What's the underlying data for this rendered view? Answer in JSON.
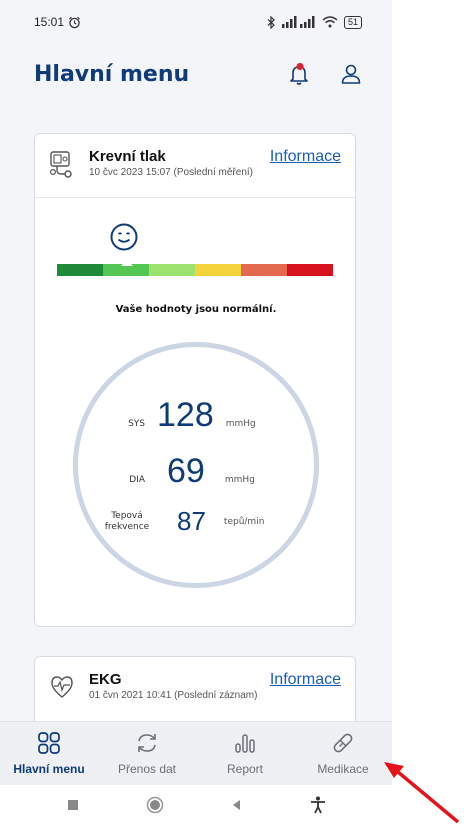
{
  "status_bar": {
    "time": "15:01",
    "battery": "51"
  },
  "header": {
    "title": "Hlavní menu"
  },
  "bp_card": {
    "title": "Krevní tlak",
    "subtitle": "10 čvc 2023 15:07 (Poslední měření)",
    "info_link": "Informace",
    "status_message": "Vaše hodnoty jsou normální.",
    "scale_colors": [
      "#1e8a3a",
      "#53c653",
      "#9be36e",
      "#f2d33b",
      "#e46a4f",
      "#d7121f"
    ],
    "readings": {
      "sys": {
        "label": "SYS",
        "value": "128",
        "unit": "mmHg"
      },
      "dia": {
        "label": "DIA",
        "value": "69",
        "unit": "mmHg"
      },
      "pulse": {
        "label_line1": "Tepová",
        "label_line2": "frekvence",
        "value": "87",
        "unit": "tepů/min"
      }
    }
  },
  "ekg_card": {
    "title": "EKG",
    "subtitle": "01 čvn 2021 10:41 (Poslední záznam)",
    "info_link": "Informace"
  },
  "bottom_nav": {
    "items": [
      {
        "label": "Hlavní menu",
        "icon": "grid-icon",
        "active": true
      },
      {
        "label": "Přenos dat",
        "icon": "sync-icon",
        "active": false
      },
      {
        "label": "Report",
        "icon": "bar-chart-icon",
        "active": false
      },
      {
        "label": "Medikace",
        "icon": "pill-icon",
        "active": false
      }
    ]
  },
  "colors": {
    "primary": "#0f3b78",
    "link": "#1b5db5",
    "notification_dot": "#e0242f",
    "annotation_arrow": "#e3141b"
  }
}
